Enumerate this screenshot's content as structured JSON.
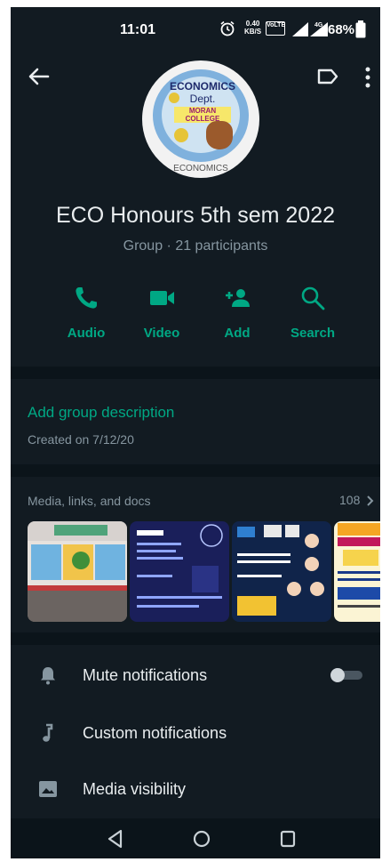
{
  "status_bar": {
    "time": "11:01",
    "speed_value": "0.40",
    "speed_unit": "KB/S",
    "volte": "VoLTE",
    "network": "4G",
    "battery": "68%"
  },
  "header": {
    "back_icon": "arrow-left-icon",
    "label_icon": "label-icon",
    "more_icon": "more-vertical-icon"
  },
  "avatar": {
    "line1": "ECONOMICS",
    "line2": "Dept.",
    "line3": "MORAN COLLEGE",
    "line4": "ECONOMICS"
  },
  "group": {
    "name": "ECO Honours 5th sem 2022",
    "subtitle": "Group · 21 participants"
  },
  "actions": [
    {
      "label": "Audio",
      "icon": "phone-icon"
    },
    {
      "label": "Video",
      "icon": "video-icon"
    },
    {
      "label": "Add",
      "icon": "add-person-icon"
    },
    {
      "label": "Search",
      "icon": "search-icon"
    }
  ],
  "description": {
    "add_label": "Add group description",
    "created": "Created on 7/12/20"
  },
  "media": {
    "title": "Media, links, and docs",
    "count": "108"
  },
  "settings": [
    {
      "label": "Mute notifications",
      "icon": "bell-icon",
      "toggle": false
    },
    {
      "label": "Custom notifications",
      "icon": "music-note-icon"
    },
    {
      "label": "Media visibility",
      "icon": "image-icon"
    }
  ],
  "colors": {
    "accent": "#00a884",
    "background": "#121b22",
    "separator": "#0b141a",
    "text_primary": "#e9edef",
    "text_secondary": "#8696a0"
  }
}
